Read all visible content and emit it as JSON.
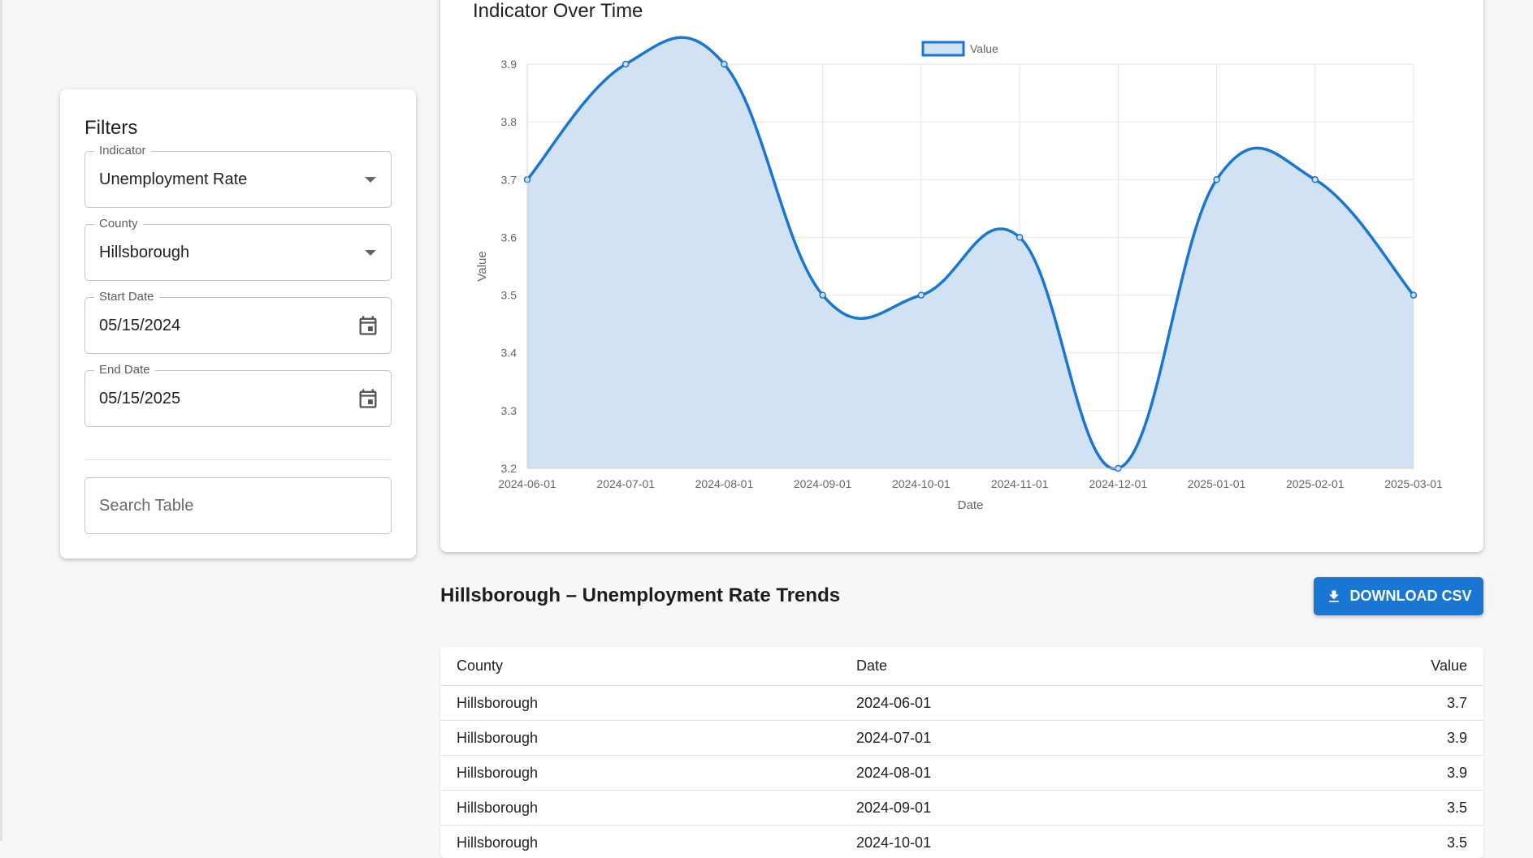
{
  "filters": {
    "title": "Filters",
    "indicator": {
      "label": "Indicator",
      "value": "Unemployment Rate"
    },
    "county": {
      "label": "County",
      "value": "Hillsborough"
    },
    "start_date": {
      "label": "Start Date",
      "value": "05/15/2024"
    },
    "end_date": {
      "label": "End Date",
      "value": "05/15/2025"
    },
    "search_placeholder": "Search Table"
  },
  "chart_card": {
    "title": "Indicator Over Time"
  },
  "chart_data": {
    "type": "area",
    "title": "Indicator Over Time",
    "xlabel": "Date",
    "ylabel": "Value",
    "x": [
      "2024-06-01",
      "2024-07-01",
      "2024-08-01",
      "2024-09-01",
      "2024-10-01",
      "2024-11-01",
      "2024-12-01",
      "2025-01-01",
      "2025-02-01",
      "2025-03-01"
    ],
    "series": [
      {
        "name": "Value",
        "values": [
          3.7,
          3.9,
          3.9,
          3.5,
          3.5,
          3.6,
          3.2,
          3.7,
          3.7,
          3.5
        ]
      }
    ],
    "ylim": [
      3.2,
      3.9
    ],
    "yticks": [
      "3.9",
      "3.8",
      "3.7",
      "3.6",
      "3.5",
      "3.4",
      "3.3",
      "3.2"
    ],
    "grid": true,
    "legend": "top-center",
    "colors": {
      "line": "#1976d2",
      "fill": "#d0e2f4"
    }
  },
  "table_section": {
    "title": "Hillsborough – Unemployment Rate Trends",
    "download_label": "DOWNLOAD CSV",
    "columns": [
      "County",
      "Date",
      "Value"
    ],
    "rows": [
      [
        "Hillsborough",
        "2024-06-01",
        "3.7"
      ],
      [
        "Hillsborough",
        "2024-07-01",
        "3.9"
      ],
      [
        "Hillsborough",
        "2024-08-01",
        "3.9"
      ],
      [
        "Hillsborough",
        "2024-09-01",
        "3.5"
      ],
      [
        "Hillsborough",
        "2024-10-01",
        "3.5"
      ]
    ]
  },
  "theme": {
    "primary": "#1976d2",
    "background": "#f7f7f9"
  }
}
